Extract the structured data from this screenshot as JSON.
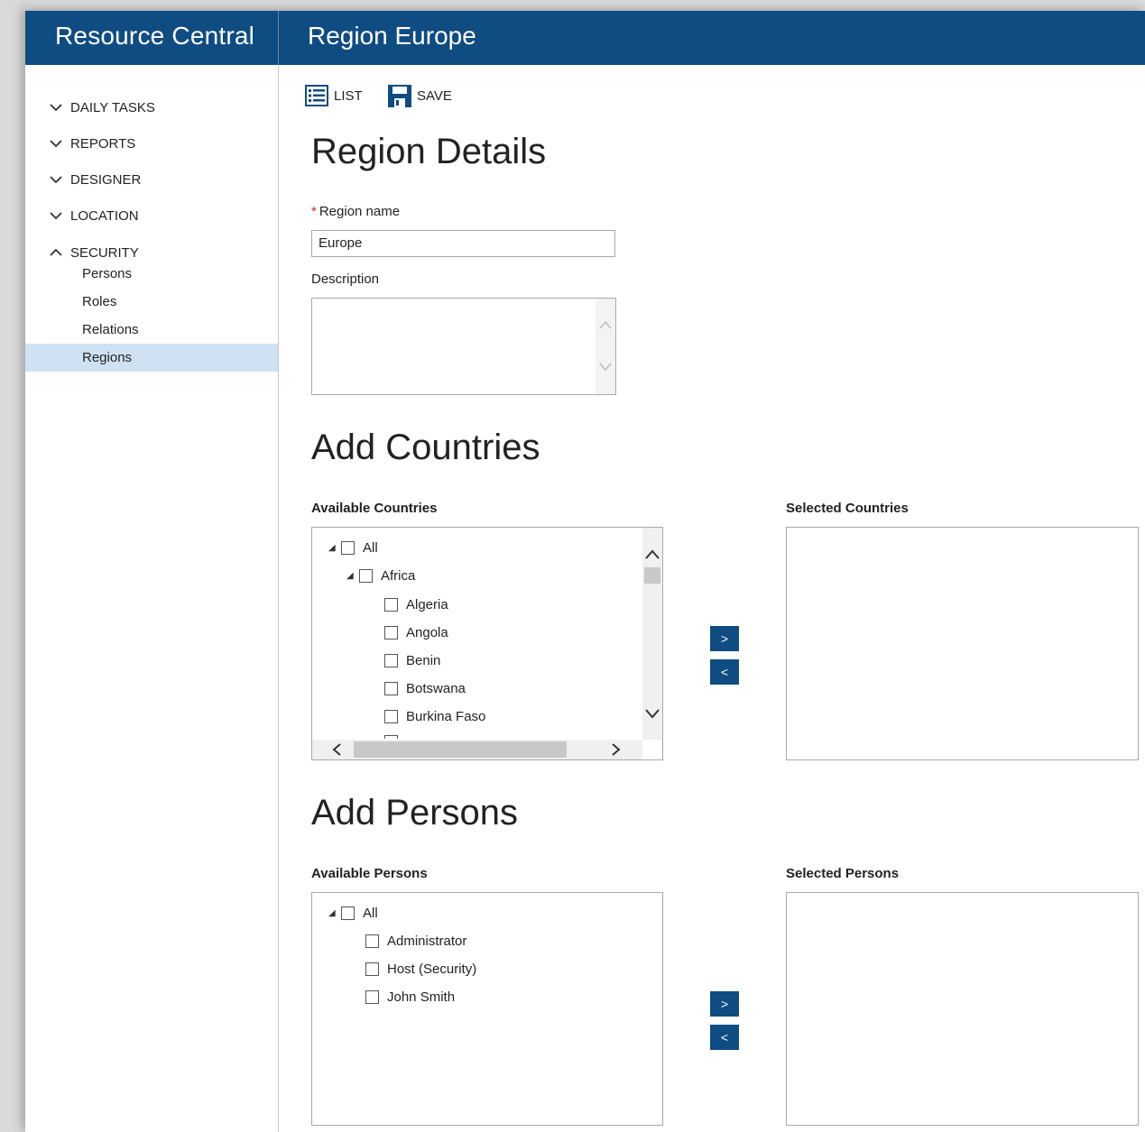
{
  "header": {
    "app_title": "Resource Central",
    "page_title": "Region Europe"
  },
  "sidebar": {
    "groups": [
      {
        "label": "DAILY TASKS",
        "expanded": false
      },
      {
        "label": "REPORTS",
        "expanded": false
      },
      {
        "label": "DESIGNER",
        "expanded": false
      },
      {
        "label": "LOCATION",
        "expanded": false
      },
      {
        "label": "SECURITY",
        "expanded": true
      }
    ],
    "security_items": [
      "Persons",
      "Roles",
      "Relations",
      "Regions"
    ],
    "active_item": "Regions"
  },
  "toolbar": {
    "list_label": "LIST",
    "save_label": "SAVE"
  },
  "region_details": {
    "heading": "Region Details",
    "name_label": "Region name",
    "name_required_mark": "*",
    "name_value": "Europe",
    "description_label": "Description",
    "description_value": ""
  },
  "add_countries": {
    "heading": "Add Countries",
    "available_label": "Available Countries",
    "selected_label": "Selected Countries",
    "tree_root": "All",
    "tree_group": "Africa",
    "tree_items": [
      "Algeria",
      "Angola",
      "Benin",
      "Botswana",
      "Burkina Faso"
    ],
    "add_button": ">",
    "remove_button": "<"
  },
  "add_persons": {
    "heading": "Add Persons",
    "available_label": "Available Persons",
    "selected_label": "Selected Persons",
    "tree_root": "All",
    "tree_items": [
      "Administrator",
      "Host (Security)",
      "John Smith"
    ],
    "add_button": ">",
    "remove_button": "<"
  },
  "colors": {
    "brand": "#0f4c81",
    "active_nav": "#cfe2f3",
    "required": "#c0392b"
  },
  "icons": {
    "list": "list-icon",
    "save": "save-icon",
    "chevron_down": "chevron-down-icon",
    "chevron_up": "chevron-up-icon",
    "tree_expanded": "tree-expanded-icon"
  }
}
